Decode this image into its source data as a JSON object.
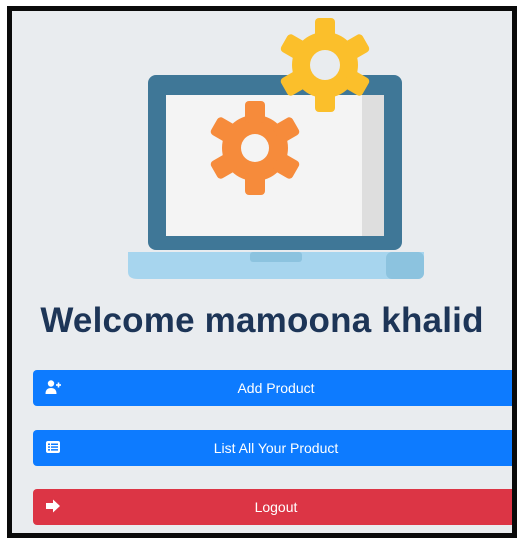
{
  "welcome_text": "Welcome mamoona khalid",
  "buttons": {
    "add_product": {
      "label": "Add Product",
      "icon": "user-plus-icon"
    },
    "list_products": {
      "label": "List All Your Product",
      "icon": "list-icon"
    },
    "logout": {
      "label": "Logout",
      "icon": "sign-out-icon"
    }
  },
  "illustration": {
    "icon": "laptop-with-gears-illustration"
  },
  "colors": {
    "primary": "#0d7bff",
    "danger": "#dc3545",
    "heading": "#1d3557",
    "background": "#e9ecef",
    "gear_orange": "#f68b3b",
    "gear_yellow": "#fbbf2b"
  }
}
